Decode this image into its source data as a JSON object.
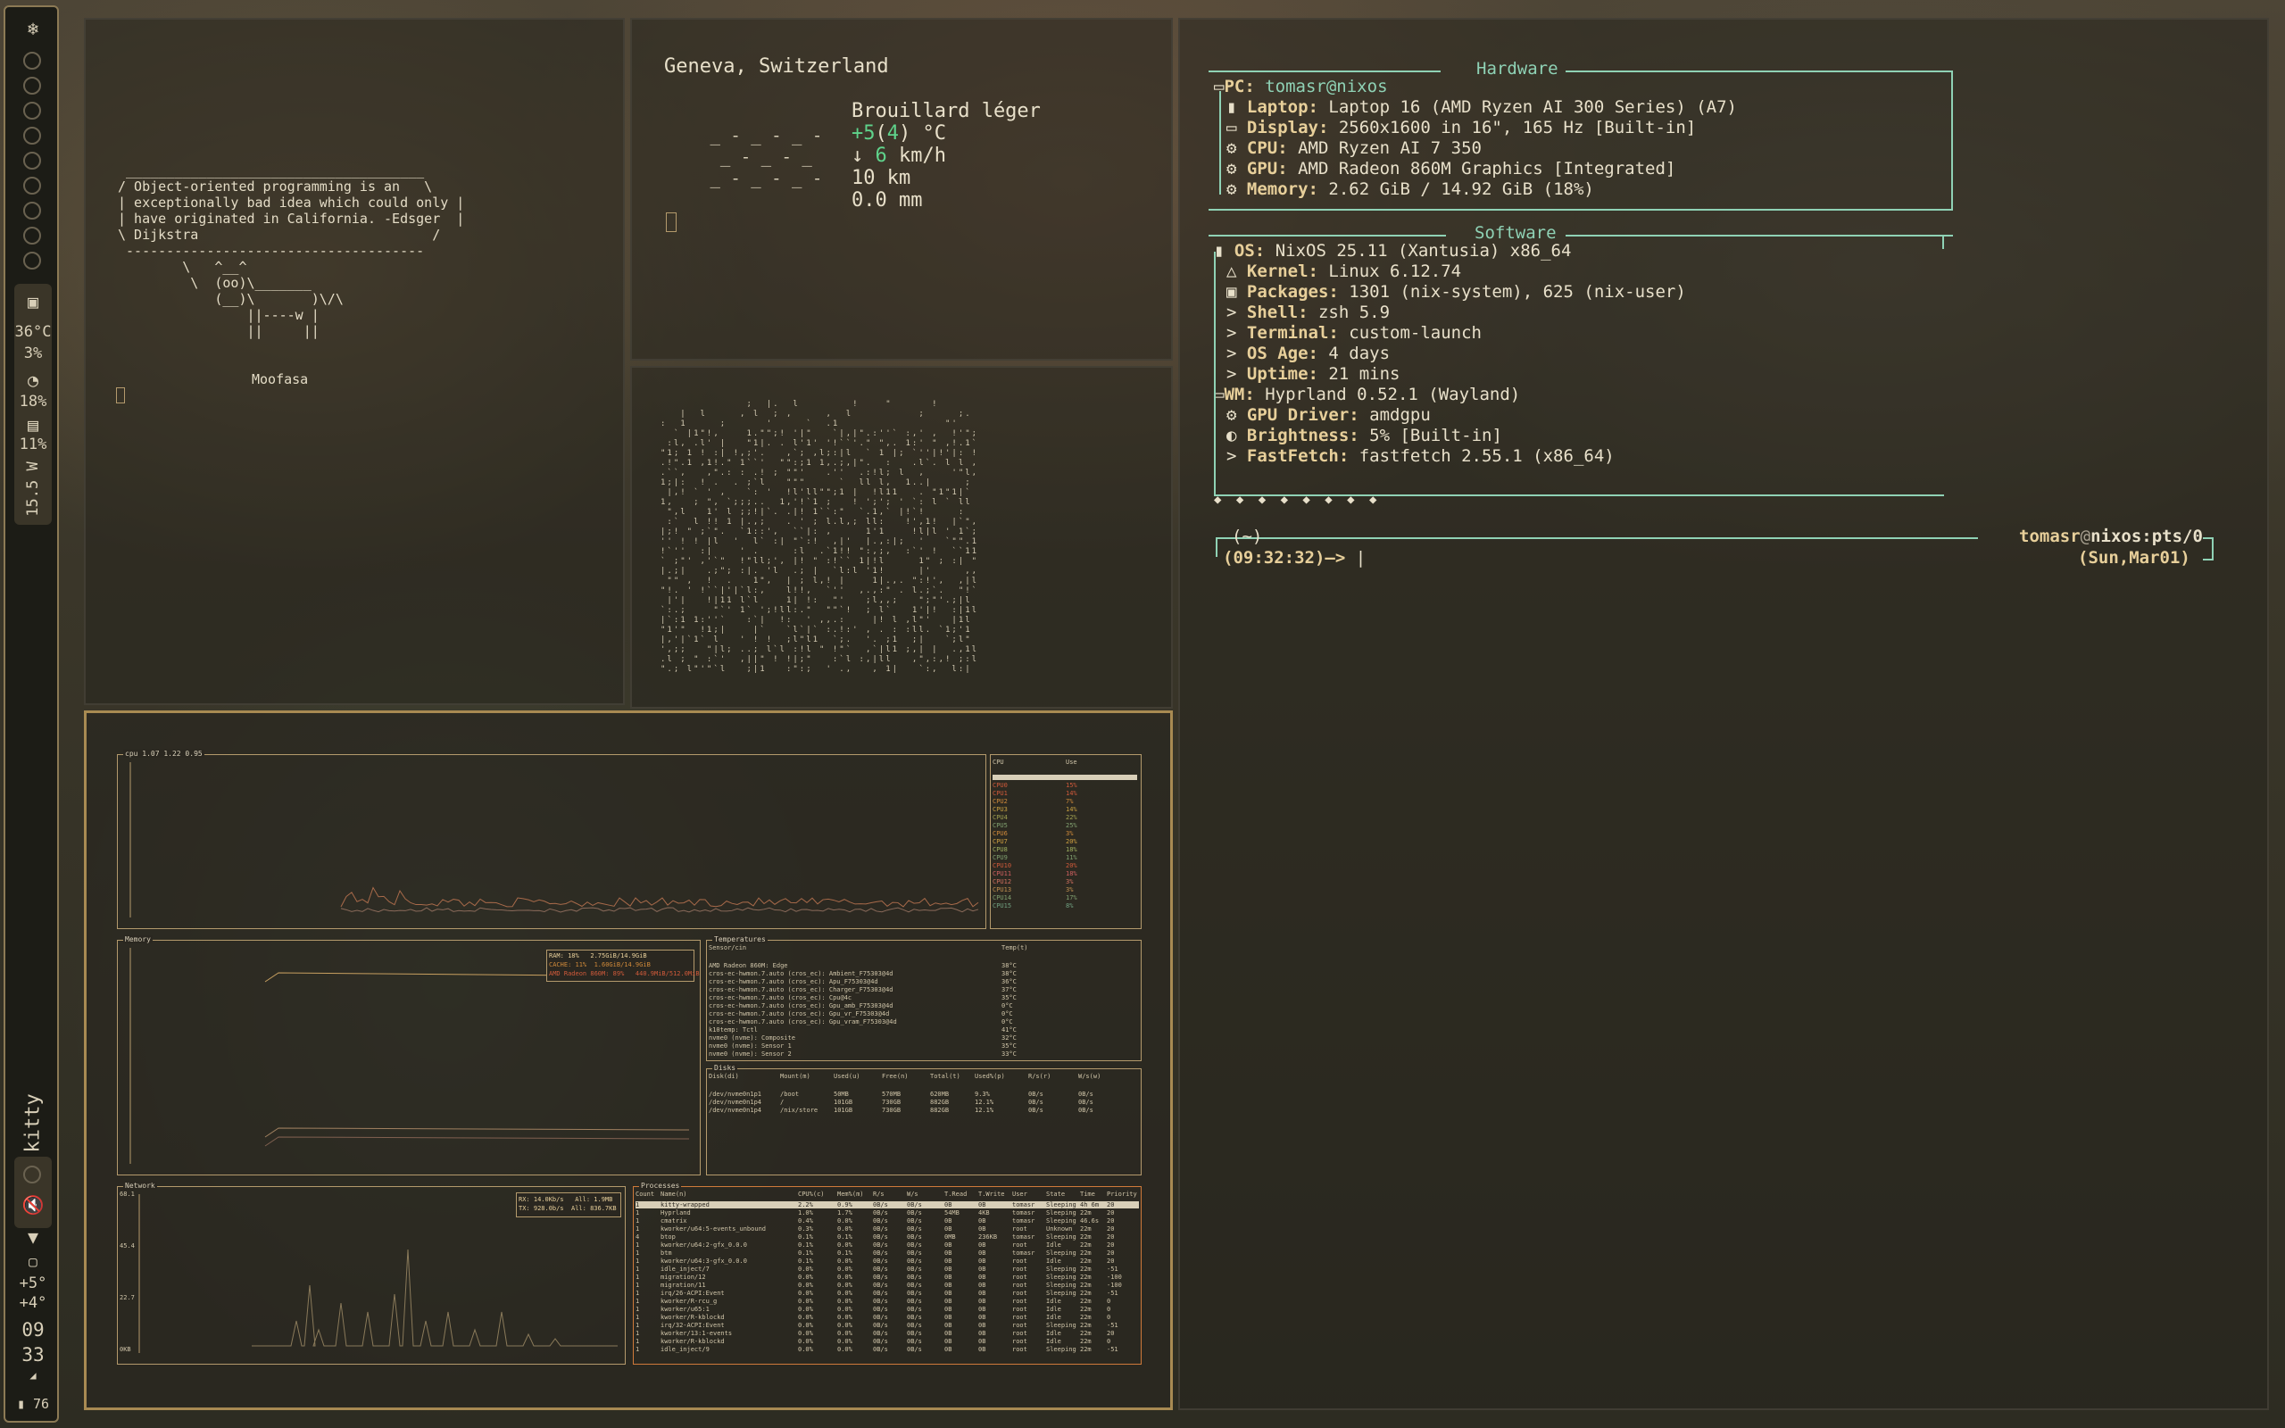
{
  "sidebar": {
    "temp": "36°C",
    "cpu": "3%",
    "mem": "18%",
    "disk": "11%",
    "power": "15.5 W",
    "window_class": "kitty",
    "weather_now": "+5°",
    "weather_feels": "+4°",
    "hour": "09",
    "minute": "33",
    "battery": "76"
  },
  "cowsay": {
    "lines": [
      " _____________________________________",
      "/ Object-oriented programming is an   \\",
      "| exceptionally bad idea which could only |",
      "| have originated in California. -Edsger  |",
      "\\ Dijkstra                             /",
      " -------------------------------------",
      "        \\   ^__^",
      "         \\  (oo)\\_______",
      "            (__)\\       )\\/\\",
      "                ||----w |",
      "                ||     ||"
    ],
    "name": "Moofasa"
  },
  "weather": {
    "location": "Geneva, Switzerland",
    "condition": "Brouillard léger",
    "temp_prefix": "+5",
    "temp_feels": "4",
    "temp_unit": "°C",
    "wind_arrow": "↓",
    "wind_speed": "6",
    "wind_unit": "km/h",
    "visibility": "10 km",
    "precip": "0.0 mm",
    "fog_art": [
      " _ - _ - _ -",
      "  _ - _ - _",
      " _ - _ - _ -"
    ]
  },
  "fastfetch": {
    "hardware_title": "Hardware",
    "software_title": "Software",
    "pc_key": "PC:",
    "pc_val": "tomasr@nixos",
    "hardware": [
      {
        "icon": "▮",
        "key": "Laptop:",
        "val": "Laptop 16 (AMD Ryzen AI 300 Series) (A7)"
      },
      {
        "icon": "▭",
        "key": "Display:",
        "val": "2560x1600 in 16\", 165 Hz [Built-in]"
      },
      {
        "icon": "⚙",
        "key": "CPU:",
        "val": "AMD Ryzen AI 7 350"
      },
      {
        "icon": "⚙",
        "key": "GPU:",
        "val": "AMD Radeon 860M Graphics [Integrated]"
      },
      {
        "icon": "⚙",
        "key": "Memory:",
        "val": "2.62 GiB / 14.92 GiB (18%)"
      }
    ],
    "os_key": "OS:",
    "os_val": "NixOS 25.11 (Xantusia) x86_64",
    "software": [
      {
        "icon": "△",
        "key": "Kernel:",
        "val": "Linux 6.12.74"
      },
      {
        "icon": "▣",
        "key": "Packages:",
        "val": "1301 (nix-system), 625 (nix-user)"
      },
      {
        "icon": ">",
        "key": "Shell:",
        "val": "zsh 5.9"
      },
      {
        "icon": ">",
        "key": "Terminal:",
        "val": "custom-launch"
      },
      {
        "icon": ">",
        "key": "OS Age:",
        "val": "4 days"
      },
      {
        "icon": ">",
        "key": "Uptime:",
        "val": "21 mins"
      }
    ],
    "wm_key": "WM:",
    "wm_val": "Hyprland 0.52.1 (Wayland)",
    "wm_items": [
      {
        "icon": "⚙",
        "key": "GPU Driver:",
        "val": "amdgpu"
      },
      {
        "icon": "◐",
        "key": "Brightness:",
        "val": "5% [Built-in]"
      },
      {
        "icon": ">",
        "key": "FastFetch:",
        "val": "fastfetch 2.55.1 (x86_64)"
      }
    ],
    "color_dots": "◆ ◆ ◆ ◆ ◆ ◆ ◆ ◆"
  },
  "prompt": {
    "dir": "(~)",
    "time": "(09:32:32)",
    "arrow": "—>",
    "user": "tomasr",
    "host": "nixos:pts/0",
    "date": "(Sun,Mar01)"
  },
  "btop": {
    "cpu_title": "cpu 1.07 1.22 0.95",
    "cpu_label": "CPU",
    "cpu_col": "Use",
    "cpu_rows": [
      "CPU0 15%",
      "CPU1 14%",
      "CPU2 7%",
      "CPU3 14%",
      "CPU4 22%",
      "CPU5 25%",
      "CPU6 3%",
      "CPU7 20%",
      "CPU8 18%",
      "CPU9 11%",
      "CPU10 20%",
      "CPU11 18%",
      "CPU12 3%",
      "CPU13 3%",
      "CPU14 17%",
      "CPU15 8%"
    ],
    "mem_title": "Memory",
    "mem_legend": [
      "RAM: 18%   2.75GiB/14.9GiB",
      "CACHE: 11%  1.60GiB/14.9GiB",
      "AMD Radeon 860M: 89%   440.9MiB/512.0MiB"
    ],
    "temp_title": "Temperatures",
    "temp_header": [
      "Sensor/cin",
      "Temp(t)"
    ],
    "temp_rows": [
      [
        "AMD Radeon 860M: Edge",
        "38°C"
      ],
      [
        "cros-ec-hwmon.7.auto (cros_ec): Ambient_F75303@4d",
        "38°C"
      ],
      [
        "cros-ec-hwmon.7.auto (cros_ec): Apu_F75303@4d",
        "36°C"
      ],
      [
        "cros-ec-hwmon.7.auto (cros_ec): Charger_F75303@4d",
        "37°C"
      ],
      [
        "cros-ec-hwmon.7.auto (cros_ec): Cpu@4c",
        "35°C"
      ],
      [
        "cros-ec-hwmon.7.auto (cros_ec): Gpu_amb_F75303@4d",
        "0°C"
      ],
      [
        "cros-ec-hwmon.7.auto (cros_ec): Gpu_vr_F75303@4d",
        "0°C"
      ],
      [
        "cros-ec-hwmon.7.auto (cros_ec): Gpu_vram_F75303@4d",
        "0°C"
      ],
      [
        "k10temp: Tctl",
        "41°C"
      ],
      [
        "nvme0 (nvme): Composite",
        "32°C"
      ],
      [
        "nvme0 (nvme): Sensor 1",
        "35°C"
      ],
      [
        "nvme0 (nvme): Sensor 2",
        "33°C"
      ]
    ],
    "disk_title": "Disks",
    "disk_header": [
      "Disk(di)",
      "Mount(m)",
      "Used(u)",
      "Free(n)",
      "Total(t)",
      "Used%(p)",
      "R/s(r)",
      "W/s(w)"
    ],
    "disk_rows": [
      [
        "/dev/nvme0n1p1",
        "/boot",
        "50MB",
        "570MB",
        "620MB",
        "9.3%",
        "0B/s",
        "0B/s"
      ],
      [
        "/dev/nvme0n1p4",
        "/",
        "101GB",
        "730GB",
        "882GB",
        "12.1%",
        "0B/s",
        "0B/s"
      ],
      [
        "/dev/nvme0n1p4",
        "/nix/store",
        "101GB",
        "730GB",
        "882GB",
        "12.1%",
        "0B/s",
        "0B/s"
      ]
    ],
    "net_title": "Network",
    "net_legend": [
      "RX: 14.0Kb/s   All: 1.9MB",
      "TX: 928.0b/s  All: 836.7KB"
    ],
    "net_ticks": [
      "68.1",
      "45.4",
      "22.7",
      "0KB"
    ],
    "proc_title": "Processes",
    "proc_header": [
      "Count",
      "Name(n)",
      "CPU%(c)",
      "Mem%(m)",
      "R/s",
      "W/s",
      "T.Read",
      "T.Write",
      "User",
      "State",
      "Time",
      "Priority"
    ],
    "proc_rows": [
      [
        "1",
        "kitty-wrapped",
        "2.2%",
        "0.9%",
        "0B/s",
        "0B/s",
        "0B",
        "0B",
        "tomasr",
        "Sleeping",
        "4h 6m",
        "20"
      ],
      [
        "1",
        "Hyprland",
        "1.0%",
        "1.7%",
        "0B/s",
        "0B/s",
        "54MB",
        "4KB",
        "tomasr",
        "Sleeping",
        "22m",
        "20"
      ],
      [
        "1",
        "cmatrix",
        "0.4%",
        "0.0%",
        "0B/s",
        "0B/s",
        "0B",
        "0B",
        "tomasr",
        "Sleeping",
        "46.6s",
        "20"
      ],
      [
        "1",
        "kworker/u64:5-events_unbound",
        "0.3%",
        "0.0%",
        "0B/s",
        "0B/s",
        "0B",
        "0B",
        "root",
        "Unknown",
        "22m",
        "20"
      ],
      [
        "4",
        "btop",
        "0.1%",
        "0.1%",
        "0B/s",
        "0B/s",
        "0MB",
        "236KB",
        "tomasr",
        "Sleeping",
        "22m",
        "20"
      ],
      [
        "1",
        "kworker/u64:2-gfx_0.0.0",
        "0.1%",
        "0.0%",
        "0B/s",
        "0B/s",
        "0B",
        "0B",
        "root",
        "Idle",
        "22m",
        "20"
      ],
      [
        "1",
        "btm",
        "0.1%",
        "0.1%",
        "0B/s",
        "0B/s",
        "0B",
        "0B",
        "tomasr",
        "Sleeping",
        "22m",
        "20"
      ],
      [
        "1",
        "kworker/u64:3-gfx_0.0.0",
        "0.1%",
        "0.0%",
        "0B/s",
        "0B/s",
        "0B",
        "0B",
        "root",
        "Idle",
        "22m",
        "20"
      ],
      [
        "1",
        "idle_inject/7",
        "0.0%",
        "0.0%",
        "0B/s",
        "0B/s",
        "0B",
        "0B",
        "root",
        "Sleeping",
        "22m",
        "-51"
      ],
      [
        "1",
        "migration/12",
        "0.0%",
        "0.0%",
        "0B/s",
        "0B/s",
        "0B",
        "0B",
        "root",
        "Sleeping",
        "22m",
        "-100"
      ],
      [
        "1",
        "migration/11",
        "0.0%",
        "0.0%",
        "0B/s",
        "0B/s",
        "0B",
        "0B",
        "root",
        "Sleeping",
        "22m",
        "-100"
      ],
      [
        "1",
        "irq/26-ACPI:Event",
        "0.0%",
        "0.0%",
        "0B/s",
        "0B/s",
        "0B",
        "0B",
        "root",
        "Sleeping",
        "22m",
        "-51"
      ],
      [
        "1",
        "kworker/R-rcu_g",
        "0.0%",
        "0.0%",
        "0B/s",
        "0B/s",
        "0B",
        "0B",
        "root",
        "Idle",
        "22m",
        "0"
      ],
      [
        "1",
        "kworker/u65:1",
        "0.0%",
        "0.0%",
        "0B/s",
        "0B/s",
        "0B",
        "0B",
        "root",
        "Idle",
        "22m",
        "0"
      ],
      [
        "1",
        "kworker/R-kblockd",
        "0.0%",
        "0.0%",
        "0B/s",
        "0B/s",
        "0B",
        "0B",
        "root",
        "Idle",
        "22m",
        "0"
      ],
      [
        "1",
        "irq/32-ACPI:Event",
        "0.0%",
        "0.0%",
        "0B/s",
        "0B/s",
        "0B",
        "0B",
        "root",
        "Sleeping",
        "22m",
        "-51"
      ],
      [
        "1",
        "kworker/13:1-events",
        "0.0%",
        "0.0%",
        "0B/s",
        "0B/s",
        "0B",
        "0B",
        "root",
        "Idle",
        "22m",
        "20"
      ],
      [
        "1",
        "kworker/R-kblockd",
        "0.0%",
        "0.0%",
        "0B/s",
        "0B/s",
        "0B",
        "0B",
        "root",
        "Idle",
        "22m",
        "0"
      ],
      [
        "1",
        "idle_inject/9",
        "0.0%",
        "0.0%",
        "0B/s",
        "0B/s",
        "0B",
        "0B",
        "root",
        "Sleeping",
        "22m",
        "-51"
      ]
    ]
  },
  "colors": {
    "accent": "#a88a52",
    "teal": "#8fd2b5",
    "key": "#e7cf9a",
    "green": "#5fd38b"
  }
}
